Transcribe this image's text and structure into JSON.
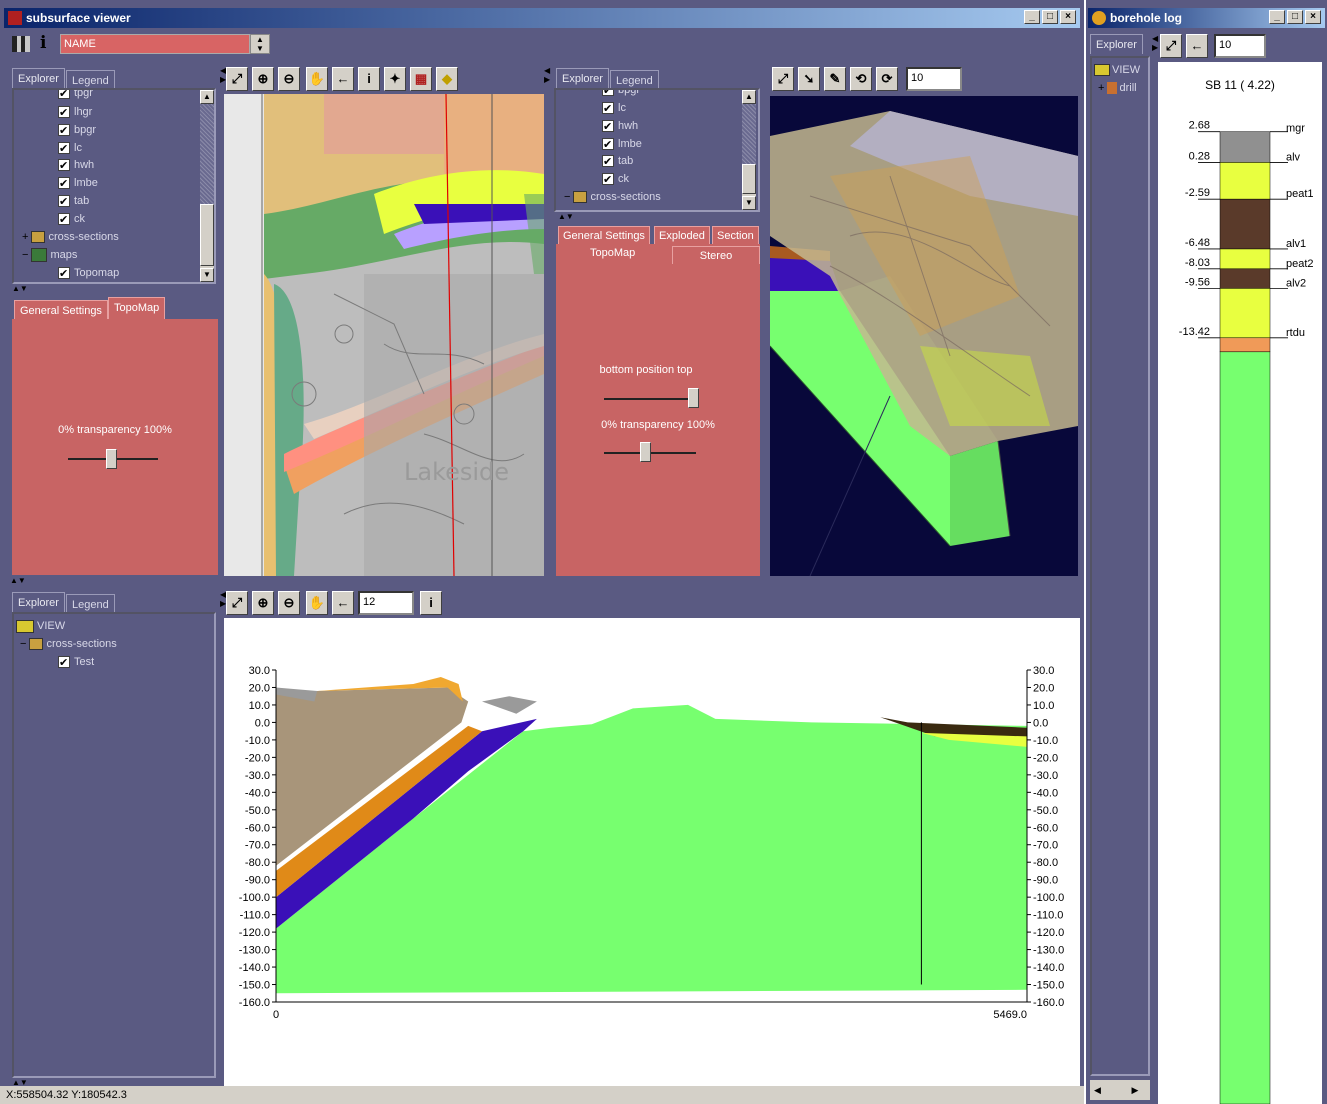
{
  "main_window": {
    "title": "subsurface viewer",
    "name_field_value": "NAME"
  },
  "map_explorer": {
    "tabs": [
      "Explorer",
      "Legend"
    ],
    "tree": [
      {
        "label": "tpgr",
        "checked": true
      },
      {
        "label": "lhgr",
        "checked": true
      },
      {
        "label": "bpgr",
        "checked": true
      },
      {
        "label": "lc",
        "checked": true
      },
      {
        "label": "hwh",
        "checked": true
      },
      {
        "label": "lmbe",
        "checked": true
      },
      {
        "label": "tab",
        "checked": true
      },
      {
        "label": "ck",
        "checked": true
      },
      {
        "label": "cross-sections"
      },
      {
        "label": "maps"
      },
      {
        "label": "Topomap",
        "checked": true
      }
    ],
    "settings_tabs": [
      "General Settings",
      "TopoMap"
    ],
    "transparency_label": "0% transparency 100%"
  },
  "map_view": {
    "labels": [
      "Lakeside"
    ]
  },
  "explorer_3d": {
    "tabs": [
      "Explorer",
      "Legend"
    ],
    "tree": [
      {
        "label": "bpgr",
        "checked": true
      },
      {
        "label": "lc",
        "checked": true
      },
      {
        "label": "hwh",
        "checked": true
      },
      {
        "label": "lmbe",
        "checked": true
      },
      {
        "label": "tab",
        "checked": true
      },
      {
        "label": "ck",
        "checked": true
      },
      {
        "label": "cross-sections"
      }
    ],
    "settings_tabs_row1": [
      "General Settings",
      "Exploded",
      "Section"
    ],
    "settings_tabs_row2": [
      "TopoMap",
      "Stereo"
    ],
    "position_label": "bottom position top",
    "transparency_label": "0% transparency 100%",
    "zoom_value": "10"
  },
  "section_explorer": {
    "tabs": [
      "Explorer",
      "Legend"
    ],
    "tree": [
      {
        "label": "VIEW"
      },
      {
        "label": "cross-sections"
      },
      {
        "label": "Test",
        "checked": true
      }
    ],
    "zoom_value": "12"
  },
  "chart_data": {
    "type": "area",
    "y_ticks_left": [
      "30.0",
      "20.0",
      "10.0",
      "0.0",
      "-10.0",
      "-20.0",
      "-30.0",
      "-40.0",
      "-50.0",
      "-60.0",
      "-70.0",
      "-80.0",
      "-90.0",
      "-100.0",
      "-110.0",
      "-120.0",
      "-130.0",
      "-140.0",
      "-150.0",
      "-160.0"
    ],
    "y_ticks_right": [
      "30.0",
      "20.0",
      "10.0",
      "0.0",
      "-10.0",
      "-20.0",
      "-30.0",
      "-40.0",
      "-50.0",
      "-60.0",
      "-70.0",
      "-80.0",
      "-90.0",
      "-100.0",
      "-110.0",
      "-120.0",
      "-130.0",
      "-140.0",
      "-150.0",
      "-160.0"
    ],
    "x_ticks": [
      "0",
      "5469.0"
    ],
    "xlim": [
      0,
      5469
    ],
    "ylim": [
      -160,
      30
    ],
    "colors": {
      "chalk": "#77ff6f",
      "blue_unit": "#3a10b8",
      "orange_unit": "#e08a18",
      "brown_unit": "#a8957a",
      "top_orange": "#f0a830",
      "grey": "#9a9a9a"
    }
  },
  "status_bar": {
    "coords": "X:558504.32 Y:180542.3"
  },
  "borehole_window": {
    "title": "borehole log",
    "tab": "Explorer",
    "tree": [
      {
        "label": "VIEW"
      },
      {
        "label": "drill"
      }
    ],
    "zoom_value": "10",
    "log_title": "SB 11  ( 4.22)",
    "layers": [
      {
        "depth": "2.68",
        "name": "mgr",
        "color": "#909090"
      },
      {
        "depth": "0.28",
        "name": "alv",
        "color": "#e8ff40"
      },
      {
        "depth": "-2.59",
        "name": "peat1",
        "color": "#5a3a2a"
      },
      {
        "depth": "-6.48",
        "name": "alv1",
        "color": "#e8ff40"
      },
      {
        "depth": "-8.03",
        "name": "peat2",
        "color": "#5a3a2a"
      },
      {
        "depth": "-9.56",
        "name": "alv2",
        "color": "#e8ff40"
      },
      {
        "depth": "-13.42",
        "name": "rtdu",
        "color": "#f09a58"
      }
    ],
    "base_color": "#77ff6f"
  }
}
